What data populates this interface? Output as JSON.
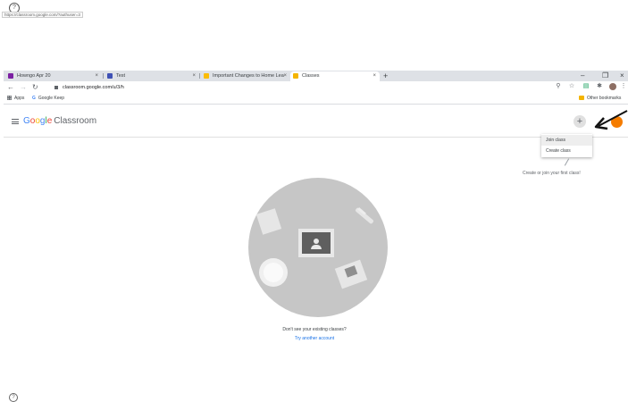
{
  "status_url": "https://classroom.google.com/?authuser=3",
  "tabs": [
    {
      "label": "Howngo Apr 20",
      "favicon_color": "#7b1fa2"
    },
    {
      "label": "Test",
      "favicon_color": "#3f51b5"
    },
    {
      "label": "Important Changes to Home Lea",
      "favicon_color": "#fbbc05"
    },
    {
      "label": "Classes",
      "favicon_color": "#f4b400"
    }
  ],
  "tab_close": "×",
  "new_tab": "+",
  "window_controls": {
    "minimize": "–",
    "restore": "❐",
    "close": "×"
  },
  "address": "classroom.google.com/u/3/h",
  "bookmarks": {
    "apps": "Apps",
    "keep": "Google Keep",
    "other": "Other bookmarks"
  },
  "app": {
    "brand_google": [
      "G",
      "o",
      "o",
      "g",
      "l",
      "e"
    ],
    "brand_product": "Classroom",
    "plus": "+"
  },
  "menu": {
    "join": "Join class",
    "create": "Create class"
  },
  "hint": "Create or join your first class!",
  "empty": {
    "message": "Don't see your existing classes?",
    "link": "Try another account"
  },
  "colors": {
    "accent": "#1a73e8",
    "avatar": "#f57c00"
  }
}
